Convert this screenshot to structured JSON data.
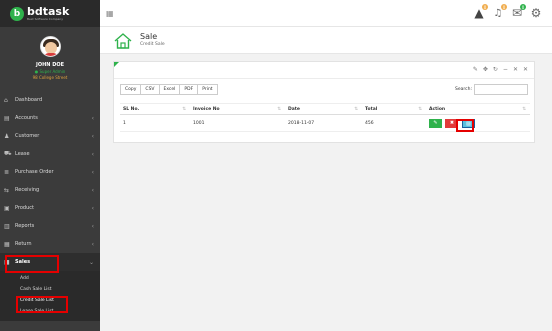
{
  "brand": {
    "name": "bdtask",
    "tagline": "Best Software Company",
    "logo_letter": "b"
  },
  "topbar": {
    "grid_icon": "grid-icon",
    "icons": [
      {
        "name": "warning-icon",
        "glyph": "▲",
        "badge": "0",
        "badge_color": "#f0ad4e"
      },
      {
        "name": "bell-icon",
        "glyph": "🔔",
        "badge": "0",
        "badge_color": "#f0ad4e"
      },
      {
        "name": "mail-icon",
        "glyph": "✉",
        "badge": "0",
        "badge_color": "#2fb24c"
      },
      {
        "name": "gear-icon",
        "glyph": "⚙",
        "badge": "",
        "badge_color": ""
      }
    ]
  },
  "profile": {
    "name": "JOHN DOE",
    "status": "● Super Admin",
    "address": "98 College Street"
  },
  "sidebar": {
    "items": [
      {
        "icon": "⌂",
        "label": "Dashboard",
        "arrow": ""
      },
      {
        "icon": "▤",
        "label": "Accounts",
        "arrow": "‹"
      },
      {
        "icon": "♟",
        "label": "Customer",
        "arrow": "‹"
      },
      {
        "icon": "⛟",
        "label": "Lease",
        "arrow": "‹"
      },
      {
        "icon": "≣",
        "label": "Purchase Order",
        "arrow": "‹"
      },
      {
        "icon": "⇆",
        "label": "Receiving",
        "arrow": "‹"
      },
      {
        "icon": "▣",
        "label": "Product",
        "arrow": "‹"
      },
      {
        "icon": "▥",
        "label": "Reports",
        "arrow": "‹"
      },
      {
        "icon": "▦",
        "label": "Return",
        "arrow": "‹"
      }
    ],
    "active": {
      "icon": "■",
      "label": "Sales",
      "arrow": "⌄"
    },
    "submenu": [
      "Add",
      "Cash Sale List",
      "Credit Sale List",
      "Lease Sale List"
    ]
  },
  "page": {
    "title": "Sale",
    "subtitle": "Credit Sale"
  },
  "panel": {
    "tools": [
      "✎",
      "✥",
      "↻",
      "−",
      "✕",
      "✕"
    ],
    "buttons": [
      "Copy",
      "CSV",
      "Excel",
      "PDF",
      "Print"
    ],
    "search_label": "Search:",
    "search_value": "",
    "columns": [
      "SL No.",
      "Invoice No",
      "Date",
      "Total",
      "Action"
    ],
    "rows": [
      {
        "sl": "1",
        "invoice": "1001",
        "date": "2018-11-07",
        "total": "456"
      }
    ],
    "actions": [
      {
        "name": "edit-button",
        "glyph": "✎"
      },
      {
        "name": "delete-button",
        "glyph": "✖"
      },
      {
        "name": "image-button",
        "glyph": "▨"
      }
    ]
  },
  "colors": {
    "accent": "#2fb24c",
    "highlight": "#e50000",
    "sidebar": "#3b3b3b"
  }
}
